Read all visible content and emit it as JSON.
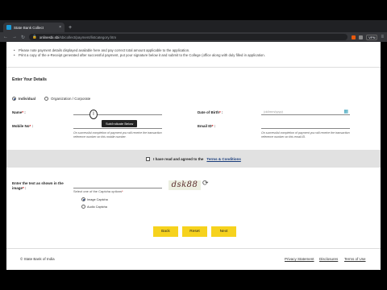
{
  "browser": {
    "tab_title": "State Bank Collect",
    "tab_close": "×",
    "new_tab": "+",
    "url_host": "onlinesbi.sbi",
    "url_path": "/sbicollect/payment/listcategory.htm",
    "vpn": "VPN"
  },
  "instructions": [
    "Please note payment details displayed available here and pay correct total amount applicable to the application.",
    "Print a copy of the e-Receipt generated after successful payment, put your signature below it and submit to the College (office along with duly filled in application."
  ],
  "details": {
    "title": "Enter Your Details",
    "radio_individual": "Individual",
    "radio_org": "Organization / Corporate",
    "name_label": "Name",
    "dob_label": "Date of Birth",
    "dob_placeholder": "(dd/mm/yyyy)",
    "mobile_label": "Mobile No",
    "email_label": "Email ID",
    "req": "*",
    "colon": " :",
    "mobile_note": "On successful completion of payment you will receive the transaction reference number on this mobile number.",
    "email_note": "On successful completion of payment you will receive the transaction reference number on this email ID.",
    "tooltip": "Sub/Indicate Below",
    "cursor_glyph": "I"
  },
  "agree": {
    "text": "I have read and agreed to the",
    "link": "Terms & Conditions"
  },
  "captcha": {
    "label_line1": "Enter the text as shown in the",
    "label_line2": "image",
    "select_label": "Select one of the Captcha options",
    "option_image": "Image Captcha",
    "option_audio": "Audio Captcha",
    "image_text": "dsk88",
    "refresh_icon": "refresh-icon"
  },
  "buttons": {
    "back": "Back",
    "reset": "Reset",
    "next": "Next"
  },
  "footer": {
    "copyright": "© State Bank of India",
    "privacy": "Privacy Statement",
    "disclosures": "Disclosures",
    "terms": "Terms of Use"
  }
}
